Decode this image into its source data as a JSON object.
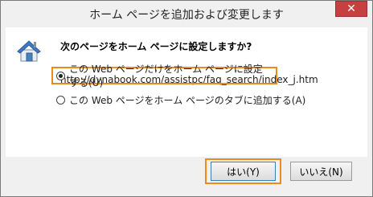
{
  "window": {
    "title": "ホーム ページを追加および変更します",
    "close_label": "✕"
  },
  "dialog": {
    "question": "次のページをホーム ページに設定しますか?",
    "url": "http://dynabook.com/assistpc/faq_search/index_j.htm",
    "options": [
      {
        "label": "この Web ページだけをホーム ページに設定する(U)",
        "selected": true
      },
      {
        "label": "この Web ページをホーム ページのタブに追加する(A)",
        "selected": false
      }
    ]
  },
  "buttons": {
    "yes_label": "はい(Y)",
    "no_label": "いいえ(N)"
  },
  "colors": {
    "highlight": "#ee8a1c",
    "close_button": "#c74040"
  },
  "icons": {
    "dialog_icon": "home-icon"
  }
}
